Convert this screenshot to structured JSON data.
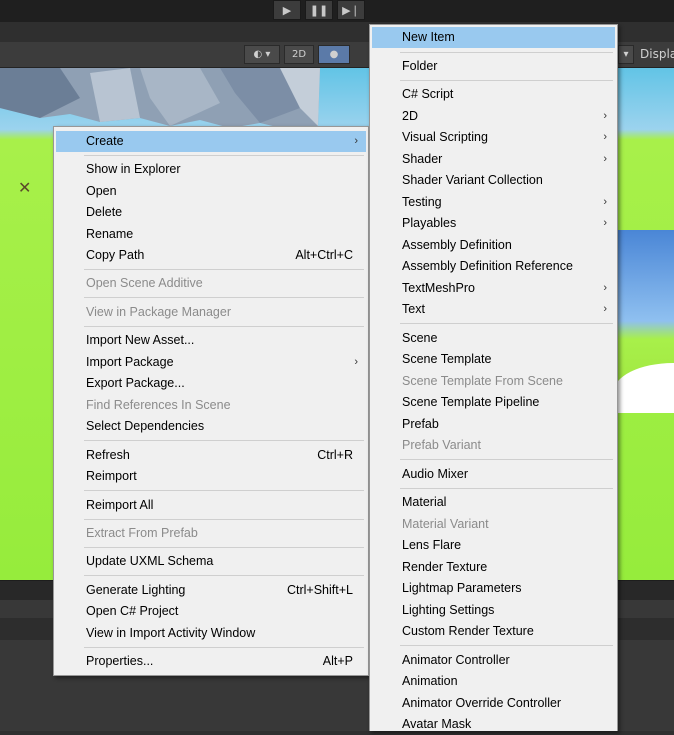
{
  "toolbar": {
    "btn_2d": "2D",
    "display": "Displa"
  },
  "menu1": {
    "items": [
      {
        "label": "Create",
        "arrow": "›"
      },
      {
        "label": "Show in Explorer"
      },
      {
        "label": "Open"
      },
      {
        "label": "Delete"
      },
      {
        "label": "Rename"
      },
      {
        "label": "Copy Path",
        "shortcut": "Alt+Ctrl+C"
      },
      {
        "label": "Open Scene Additive"
      },
      {
        "label": "View in Package Manager"
      },
      {
        "label": "Import New Asset..."
      },
      {
        "label": "Import Package",
        "arrow": "›"
      },
      {
        "label": "Export Package..."
      },
      {
        "label": "Find References In Scene"
      },
      {
        "label": "Select Dependencies"
      },
      {
        "label": "Refresh",
        "shortcut": "Ctrl+R"
      },
      {
        "label": "Reimport"
      },
      {
        "label": "Reimport All"
      },
      {
        "label": "Extract From Prefab"
      },
      {
        "label": "Update UXML Schema"
      },
      {
        "label": "Generate Lighting",
        "shortcut": "Ctrl+Shift+L"
      },
      {
        "label": "Open C# Project"
      },
      {
        "label": "View in Import Activity Window"
      },
      {
        "label": "Properties...",
        "shortcut": "Alt+P"
      }
    ]
  },
  "menu2": {
    "items": [
      {
        "label": "New Item"
      },
      {
        "label": "Folder"
      },
      {
        "label": "C# Script"
      },
      {
        "label": "2D",
        "arrow": "›"
      },
      {
        "label": "Visual Scripting",
        "arrow": "›"
      },
      {
        "label": "Shader",
        "arrow": "›"
      },
      {
        "label": "Shader Variant Collection"
      },
      {
        "label": "Testing",
        "arrow": "›"
      },
      {
        "label": "Playables",
        "arrow": "›"
      },
      {
        "label": "Assembly Definition"
      },
      {
        "label": "Assembly Definition Reference"
      },
      {
        "label": "TextMeshPro",
        "arrow": "›"
      },
      {
        "label": "Text",
        "arrow": "›"
      },
      {
        "label": "Scene"
      },
      {
        "label": "Scene Template"
      },
      {
        "label": "Scene Template From Scene"
      },
      {
        "label": "Scene Template Pipeline"
      },
      {
        "label": "Prefab"
      },
      {
        "label": "Prefab Variant"
      },
      {
        "label": "Audio Mixer"
      },
      {
        "label": "Material"
      },
      {
        "label": "Material Variant"
      },
      {
        "label": "Lens Flare"
      },
      {
        "label": "Render Texture"
      },
      {
        "label": "Lightmap Parameters"
      },
      {
        "label": "Lighting Settings"
      },
      {
        "label": "Custom Render Texture"
      },
      {
        "label": "Animator Controller"
      },
      {
        "label": "Animation"
      },
      {
        "label": "Animator Override Controller"
      },
      {
        "label": "Avatar Mask"
      }
    ]
  }
}
